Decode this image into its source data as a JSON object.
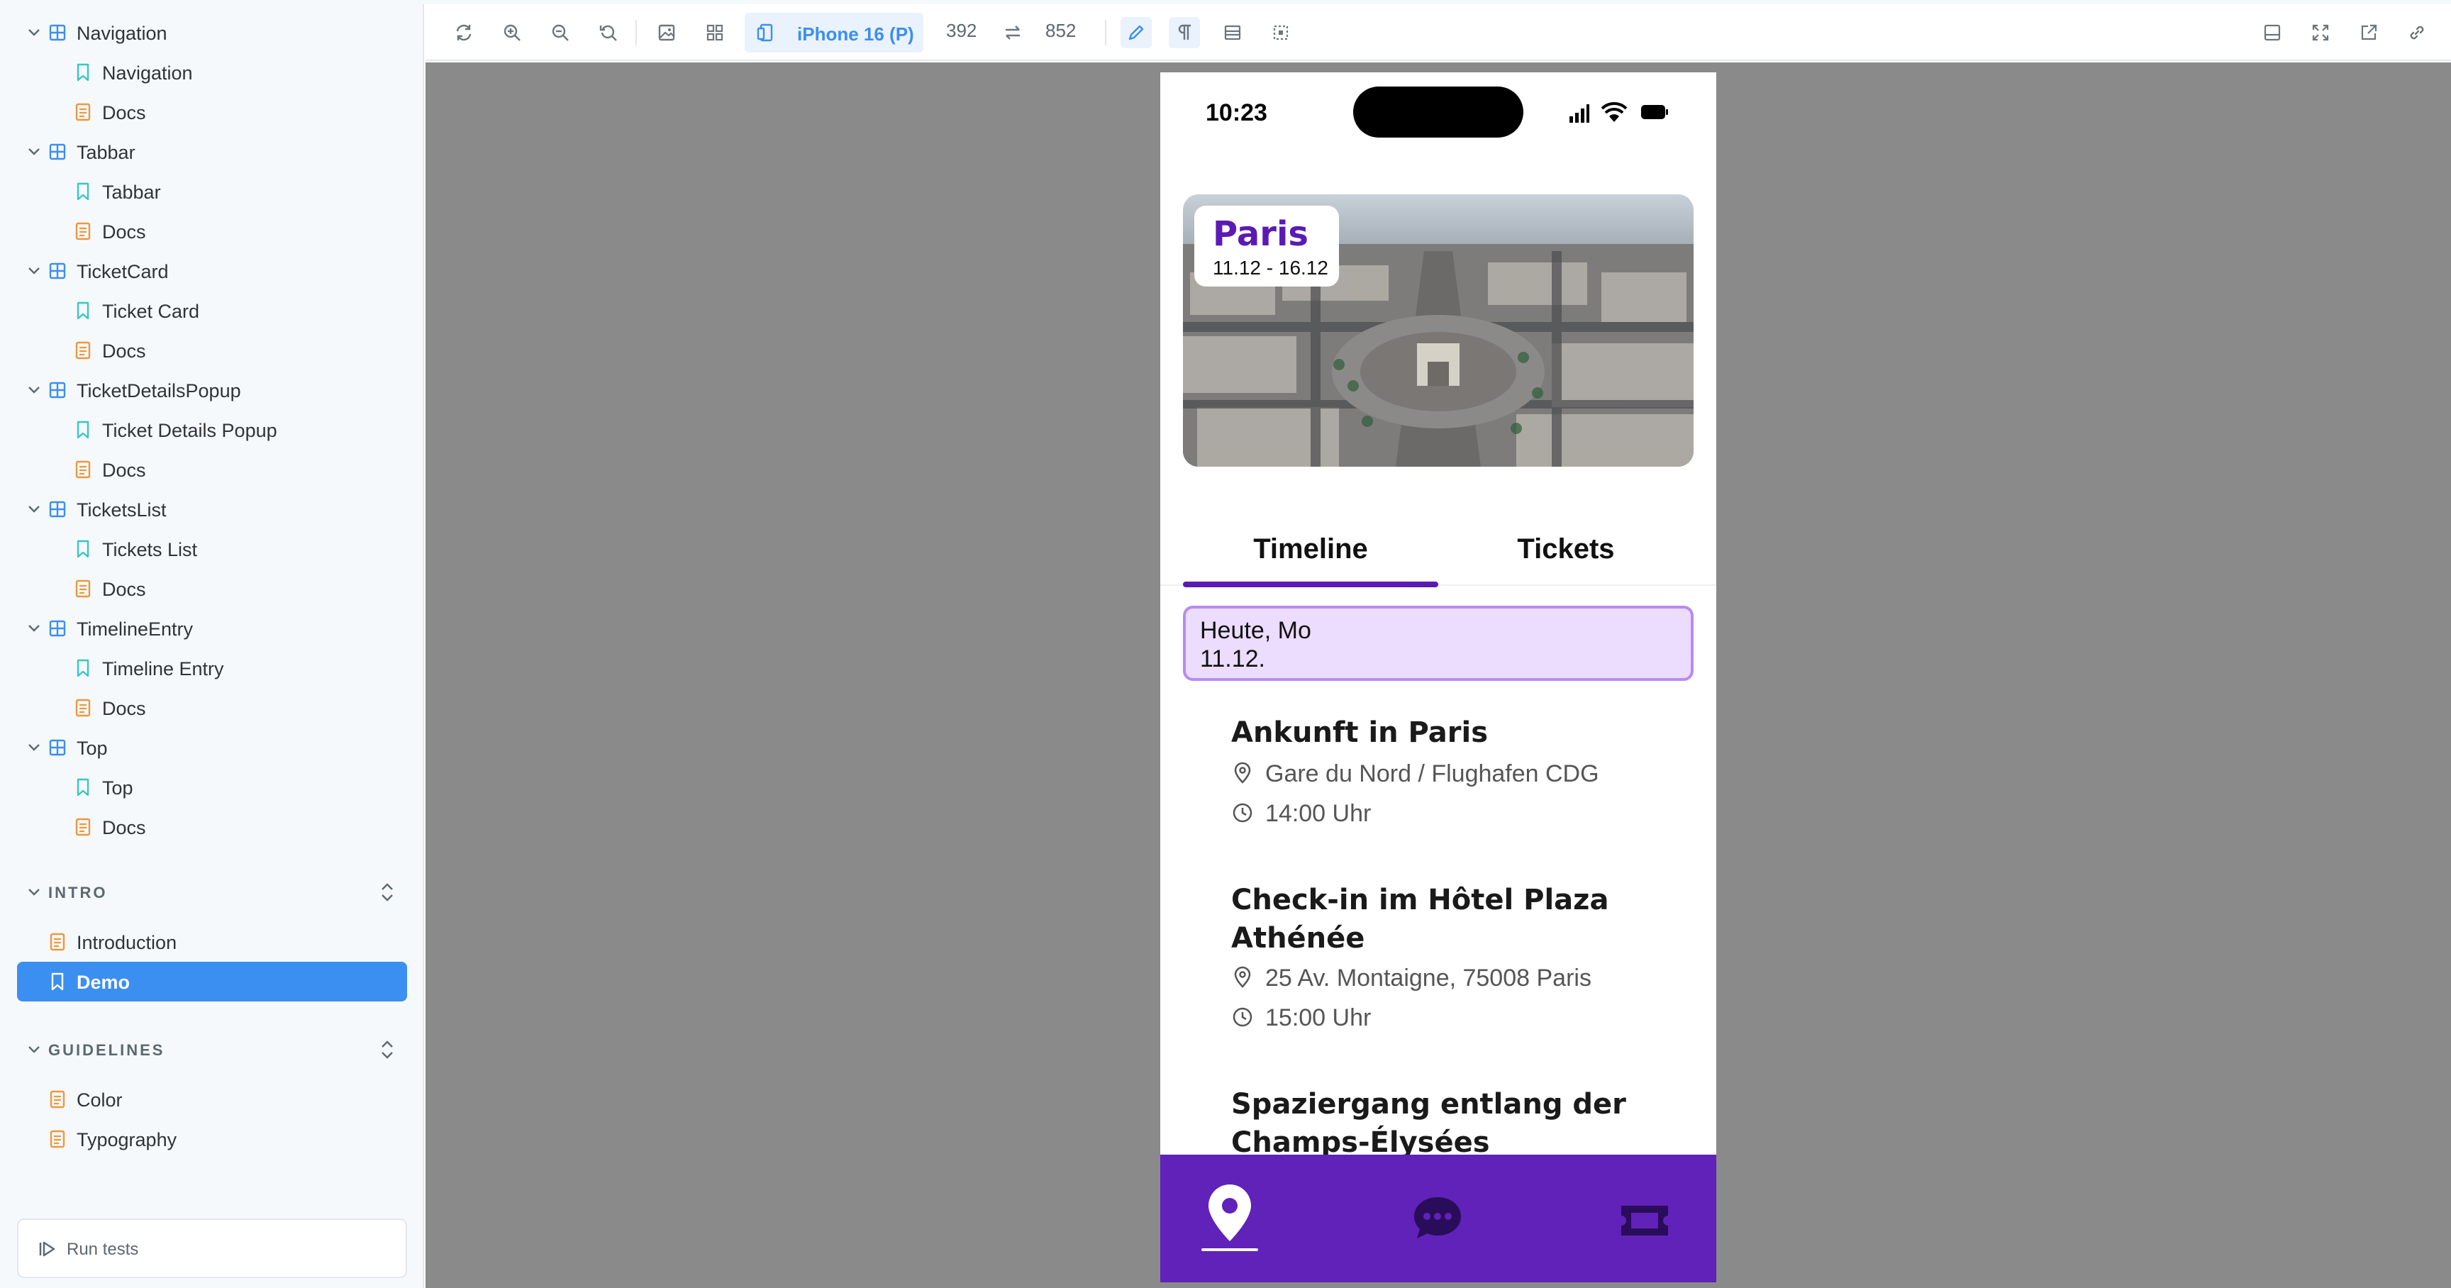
{
  "sidebar": {
    "tree": [
      {
        "label": "Navigation",
        "kind": "component",
        "level": 0
      },
      {
        "label": "Navigation",
        "kind": "story",
        "level": 1
      },
      {
        "label": "Docs",
        "kind": "docs",
        "level": 1
      },
      {
        "label": "Tabbar",
        "kind": "component",
        "level": 0
      },
      {
        "label": "Tabbar",
        "kind": "story",
        "level": 1
      },
      {
        "label": "Docs",
        "kind": "docs",
        "level": 1
      },
      {
        "label": "TicketCard",
        "kind": "component",
        "level": 0
      },
      {
        "label": "Ticket Card",
        "kind": "story",
        "level": 1
      },
      {
        "label": "Docs",
        "kind": "docs",
        "level": 1
      },
      {
        "label": "TicketDetailsPopup",
        "kind": "component",
        "level": 0
      },
      {
        "label": "Ticket Details Popup",
        "kind": "story",
        "level": 1
      },
      {
        "label": "Docs",
        "kind": "docs",
        "level": 1
      },
      {
        "label": "TicketsList",
        "kind": "component",
        "level": 0
      },
      {
        "label": "Tickets List",
        "kind": "story",
        "level": 1
      },
      {
        "label": "Docs",
        "kind": "docs",
        "level": 1
      },
      {
        "label": "TimelineEntry",
        "kind": "component",
        "level": 0
      },
      {
        "label": "Timeline Entry",
        "kind": "story",
        "level": 1
      },
      {
        "label": "Docs",
        "kind": "docs",
        "level": 1
      },
      {
        "label": "Top",
        "kind": "component",
        "level": 0
      },
      {
        "label": "Top",
        "kind": "story",
        "level": 1
      },
      {
        "label": "Docs",
        "kind": "docs",
        "level": 1
      }
    ],
    "sections": [
      {
        "label": "INTRO",
        "items": [
          {
            "label": "Introduction",
            "kind": "docs",
            "selected": false
          },
          {
            "label": "Demo",
            "kind": "story",
            "selected": true
          }
        ]
      },
      {
        "label": "GUIDELINES",
        "items": [
          {
            "label": "Color",
            "kind": "docs",
            "selected": false
          },
          {
            "label": "Typography",
            "kind": "docs",
            "selected": false
          }
        ]
      }
    ],
    "run_tests_label": "Run tests"
  },
  "toolbar": {
    "left_icons": [
      "reload-icon",
      "zoom-in-icon",
      "zoom-out-icon",
      "zoom-reset-icon",
      "image-icon",
      "grid-icon"
    ],
    "device_label": "iPhone 16 (P)",
    "width": "392",
    "height": "852",
    "right_icons": [
      "panel-icon",
      "fullscreen-icon",
      "open-new-icon",
      "copy-link-icon"
    ]
  },
  "app": {
    "status_time": "10:23",
    "city": "Paris",
    "dates": "11.12 - 16.12",
    "tabs": [
      "Timeline",
      "Tickets"
    ],
    "active_tab": "Timeline",
    "day_badge": {
      "line1": "Heute, Mo",
      "line2": "11.12."
    },
    "entries": [
      {
        "title": "Ankunft in Paris",
        "location": "Gare du Nord / Flughafen CDG",
        "time": "14:00 Uhr"
      },
      {
        "title": "Check-in im Hôtel Plaza Athénée",
        "location": "25 Av. Montaigne, 75008 Paris",
        "time": "15:00 Uhr"
      },
      {
        "title": "Spaziergang entlang der Champs-Élysées"
      }
    ],
    "nav_items": [
      "location-pin-icon",
      "chat-bubble-icon",
      "ticket-icon"
    ],
    "colors": {
      "primary": "#6022b8",
      "badge_bg": "#ecdcfd",
      "badge_border": "#b78bf0",
      "selection": "#3b8ff0"
    }
  }
}
